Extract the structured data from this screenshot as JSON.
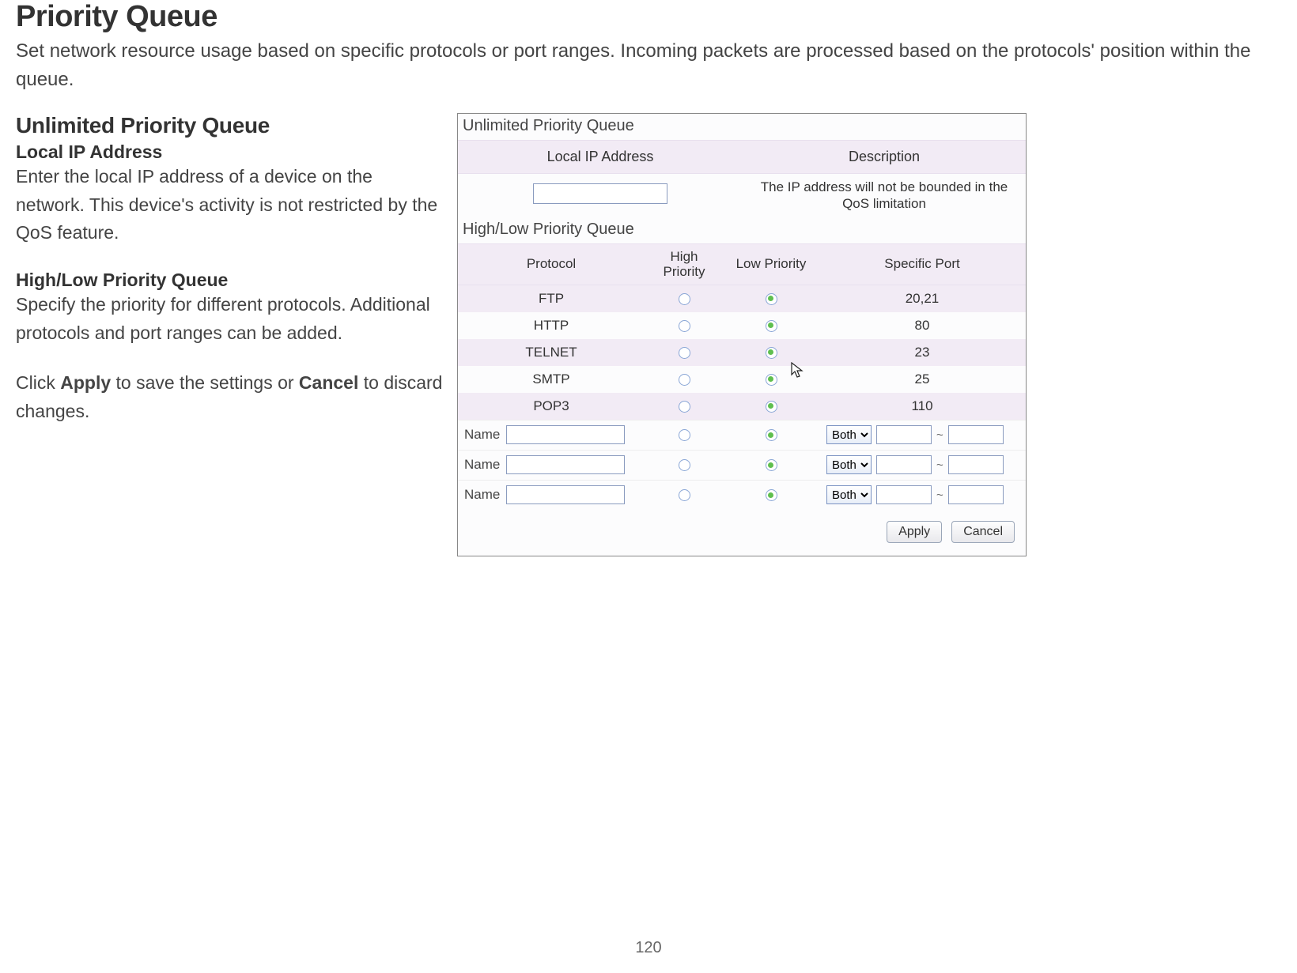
{
  "doc": {
    "title": "Priority Queue",
    "description": "Set network resource usage based on specific protocols or port ranges. Incoming packets are processed based on the protocols' position within the queue.",
    "sections": {
      "unlimited": {
        "heading": "Unlimited Priority Queue",
        "label": "Local IP Address",
        "desc": "Enter the local IP address of a device on the network. This device's activity is not restricted by the QoS feature."
      },
      "highlow": {
        "heading": "High/Low Priority Queue",
        "desc": "Specify the priority for different protocols. Additional protocols and port ranges can be added."
      },
      "actions": {
        "prefix": "Click ",
        "apply": "Apply",
        "middle": " to save the settings or ",
        "cancel": "Cancel",
        "suffix": " to discard changes."
      }
    },
    "page_number": "120"
  },
  "panel": {
    "unlimited": {
      "title": "Unlimited Priority Queue",
      "col_ip": "Local IP Address",
      "col_desc": "Description",
      "desc_text": "The IP address will not be bounded in the QoS limitation",
      "ip_value": ""
    },
    "highlow": {
      "title": "High/Low Priority Queue",
      "col_proto": "Protocol",
      "col_high_line1": "High",
      "col_high_line2": "Priority",
      "col_low": "Low Priority",
      "col_port": "Specific Port",
      "rows": [
        {
          "protocol": "FTP",
          "high": false,
          "low": true,
          "port": "20,21"
        },
        {
          "protocol": "HTTP",
          "high": false,
          "low": true,
          "port": "80"
        },
        {
          "protocol": "TELNET",
          "high": false,
          "low": true,
          "port": "23"
        },
        {
          "protocol": "SMTP",
          "high": false,
          "low": true,
          "port": "25"
        },
        {
          "protocol": "POP3",
          "high": false,
          "low": true,
          "port": "110"
        }
      ],
      "custom_name_label": "Name",
      "custom_select_option": "Both",
      "custom_rows": [
        {
          "name": "",
          "high": false,
          "low": true,
          "type": "Both",
          "port_from": "",
          "port_to": ""
        },
        {
          "name": "",
          "high": false,
          "low": true,
          "type": "Both",
          "port_from": "",
          "port_to": ""
        },
        {
          "name": "",
          "high": false,
          "low": true,
          "type": "Both",
          "port_from": "",
          "port_to": ""
        }
      ]
    },
    "buttons": {
      "apply": "Apply",
      "cancel": "Cancel"
    }
  }
}
